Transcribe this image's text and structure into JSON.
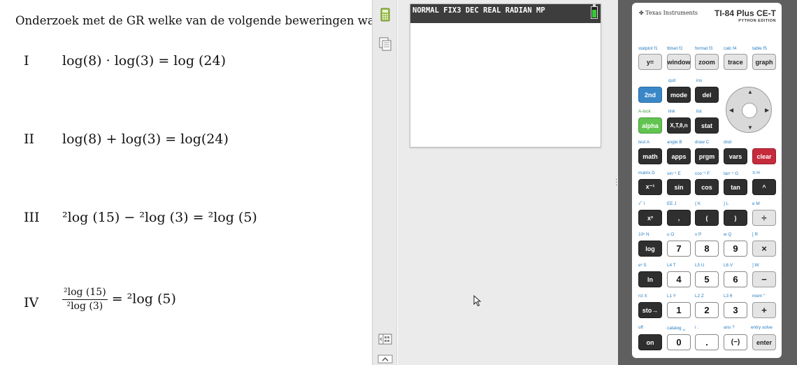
{
  "worksheet": {
    "intro": "Onderzoek met de GR welke van de volgende beweringen waar",
    "statements": [
      {
        "num": "I",
        "expr": "log(8) · log(3) = log (24)"
      },
      {
        "num": "II",
        "expr": "log(8) + log(3) = log(24)"
      },
      {
        "num": "III",
        "expr": "²log (15) − ²log (3) = ²log (5)"
      },
      {
        "num": "IV",
        "frac_top": "²log (15)",
        "frac_bot": "²log (3)",
        "rhs": "= ²log (5)"
      }
    ]
  },
  "toolbar": {
    "items": [
      {
        "icon": "calculator-icon"
      },
      {
        "icon": "copy-screen-icon"
      },
      {
        "icon": "layout-toggle-icon"
      },
      {
        "icon": "collapse-arrow-icon"
      }
    ]
  },
  "emulator_screen": {
    "status_text": "NORMAL FIX3 DEC REAL RADIAN MP",
    "battery_level": 0.8
  },
  "calculator": {
    "brand": "Texas Instruments",
    "model": "TI-84 Plus CE-T",
    "edition": "PYTHON EDITION",
    "keys": {
      "y_eq": "y=",
      "window": "window",
      "zoom": "zoom",
      "trace": "trace",
      "graph": "graph",
      "second": "2nd",
      "mode": "mode",
      "del": "del",
      "alpha": "alpha",
      "xt": "X,T,θ,n",
      "stat": "stat",
      "math": "math",
      "apps": "apps",
      "prgm": "prgm",
      "vars": "vars",
      "clear": "clear",
      "xinv": "x⁻¹",
      "sin": "sin",
      "cos": "cos",
      "tan": "tan",
      "caret": "^",
      "xsq": "x²",
      "comma": ",",
      "lparen": "(",
      "rparen": ")",
      "div": "÷",
      "log": "log",
      "k7": "7",
      "k8": "8",
      "k9": "9",
      "mul": "×",
      "ln": "ln",
      "k4": "4",
      "k5": "5",
      "k6": "6",
      "minus": "−",
      "sto": "sto→",
      "k1": "1",
      "k2": "2",
      "k3": "3",
      "plus": "+",
      "on": "on",
      "k0": "0",
      "dot": ".",
      "neg": "(−)",
      "enter": "enter"
    },
    "sublabels": {
      "r0": [
        "statplot f1",
        "tblset f2",
        "format f3",
        "calc f4",
        "table f5"
      ],
      "quit": "quit",
      "ins": "ins",
      "alock": "A-lock",
      "link": "link",
      "list": "list",
      "r3": [
        "test A",
        "angle B",
        "draw C",
        "distr"
      ],
      "r4": [
        "matrix D",
        "sin⁻¹ E",
        "cos⁻¹ F",
        "tan⁻¹ G",
        "π H"
      ],
      "r5": [
        "√‾ I",
        "EE J",
        "{ K",
        "} L",
        "e M"
      ],
      "r6": [
        "10ˣ N",
        "u O",
        "v P",
        "w Q",
        "[ R"
      ],
      "r7": [
        "eˣ S",
        "L4 T",
        "L5 U",
        "L6 V",
        "] W"
      ],
      "r8": [
        "rcl X",
        "L1 Y",
        "L2 Z",
        "L3 θ",
        "mem \""
      ],
      "r9": [
        "off",
        "catalog ␣",
        "i :",
        "ans ?",
        "entry solve"
      ]
    }
  }
}
